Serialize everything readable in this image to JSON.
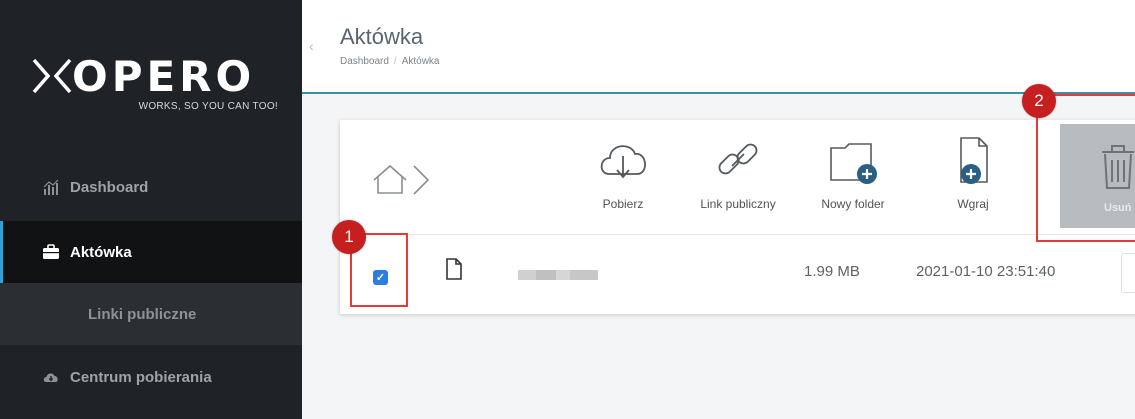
{
  "brand": {
    "logo_word": "OPERO",
    "tagline": "WORKS, SO YOU CAN TOO!"
  },
  "sidebar": {
    "items": [
      {
        "label": "Dashboard",
        "icon": "bar-chart-icon"
      },
      {
        "label": "Aktówka",
        "icon": "briefcase-icon",
        "active": true
      },
      {
        "label": "Linki publiczne"
      },
      {
        "label": "Centrum pobierania",
        "icon": "cloud-download-icon"
      }
    ]
  },
  "header": {
    "title": "Aktówka",
    "breadcrumb": [
      "Dashboard",
      "Aktówka"
    ]
  },
  "toolbar": {
    "download_label": "Pobierz",
    "public_link_label": "Link publiczny",
    "new_folder_label": "Nowy folder",
    "upload_label": "Wgraj",
    "delete_label": "Usuń"
  },
  "files": [
    {
      "selected": true,
      "size": "1.99 MB",
      "date": "2021-01-10 23:51:40"
    }
  ],
  "annotations": {
    "step1": "1",
    "step2": "2"
  },
  "colors": {
    "sidebar_bg": "#1f2226",
    "accent": "#2fa4d4",
    "highlight": "#e53a3a",
    "badge": "#c51f1f",
    "checkbox": "#2a7de1"
  }
}
